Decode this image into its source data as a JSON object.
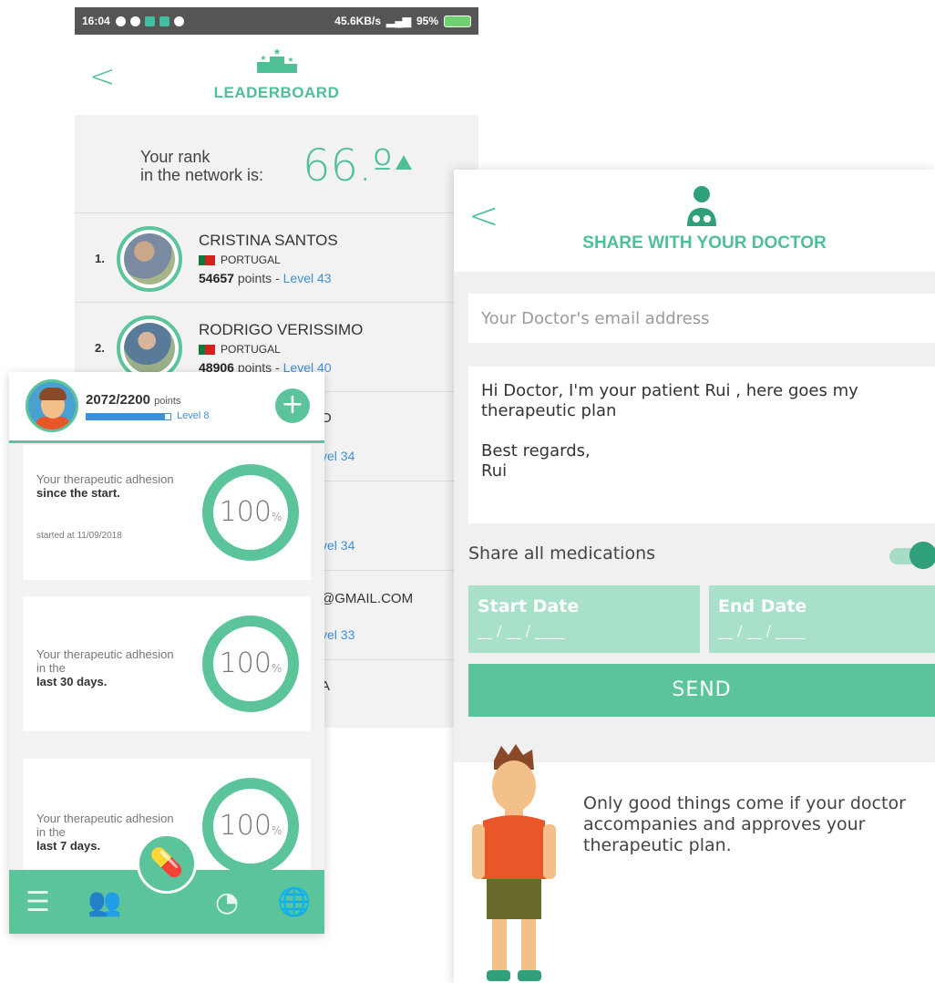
{
  "statusbar": {
    "time": "16:04",
    "speed": "45.6KB/s",
    "battery": "95%"
  },
  "leaderboard": {
    "title": "LEADERBOARD",
    "rank_label": "Your rank\nin the network is:",
    "rank_value": "66.º",
    "rows": [
      {
        "pos": "1.",
        "name": "CRISTINA SANTOS",
        "country": "PORTUGAL",
        "points": "54657",
        "points_suffix": "points - ",
        "level": "Level 43"
      },
      {
        "pos": "2.",
        "name": "RODRIGO VERISSIMO",
        "country": "PORTUGAL",
        "points": "48906",
        "points_suffix": "points - ",
        "level": "Level 40"
      }
    ],
    "partial": [
      {
        "name_tail": "O",
        "level_tail": "vel 34"
      },
      {
        "name_tail": "",
        "level_tail": "vel 34"
      },
      {
        "name_tail": "@GMAIL.COM",
        "level_tail": "vel 33"
      },
      {
        "name_tail": "A",
        "level_tail": ""
      }
    ]
  },
  "adhesion": {
    "points": "2072/2200",
    "points_unit": "points",
    "progress": 0.94,
    "level": "Level 8",
    "plus": "+",
    "cards": [
      {
        "text": "Your therapeutic adhesion",
        "bold": "since the start.",
        "started": "started at 11/09/2018",
        "value": "100",
        "unit": "%"
      },
      {
        "text": "Your therapeutic adhesion in the",
        "bold": "last 30 days.",
        "started": "",
        "value": "100",
        "unit": "%"
      },
      {
        "text": "Your therapeutic adhesion in the",
        "bold": "last 7 days.",
        "started": "",
        "value": "100",
        "unit": "%"
      }
    ],
    "nav": [
      "list-icon",
      "people-icon",
      "pill-icon",
      "chart-icon",
      "globe-icon"
    ]
  },
  "share": {
    "title": "SHARE WITH YOUR DOCTOR",
    "email_placeholder": "Your Doctor's email address",
    "message": "Hi Doctor, I'm your patient Rui , here goes my\ntherapeutic plan\n\nBest regards,\nRui",
    "share_all_label": "Share all medications",
    "share_all_on": true,
    "start_label": "Start Date",
    "end_label": "End Date",
    "date_placeholder": "__ / __ / ____",
    "send_label": "SEND",
    "tip": "Only good things come if your doctor accompanies and approves your therapeutic plan."
  },
  "colors": {
    "accent": "#5cc49b",
    "link": "#3f8fd6",
    "bg": "#f2f2f2"
  }
}
